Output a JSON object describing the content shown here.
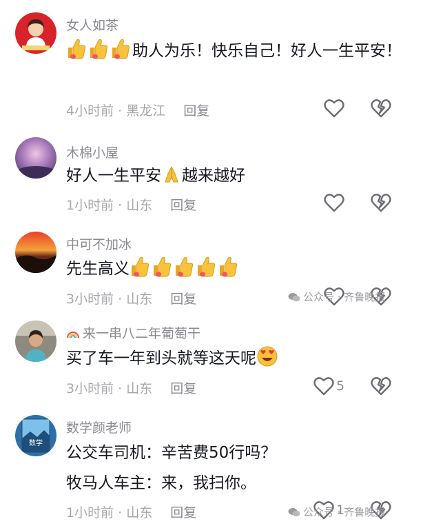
{
  "comments": [
    {
      "name": "女人如茶",
      "text": "助人为乐！快乐自己！好人一生平安！",
      "time": "4小时前 · 黑龙江",
      "reply": "回复"
    },
    {
      "name": "木棉小屋",
      "text_a": "好人一生平安",
      "text_b": "越来越好",
      "time": "1小时前 · 山东",
      "reply": "回复"
    },
    {
      "name": "中可不加冰",
      "text": "先生高义",
      "time": "3小时前 · 山东",
      "reply": "回复"
    },
    {
      "name": "来一串八二年葡萄干",
      "text": "买了车一年到头就等这天呢",
      "time": "3小时前 · 山东",
      "reply": "回复",
      "likes": "5"
    },
    {
      "name": "数学颜老师",
      "line1": "公交车司机：辛苦费50行吗？",
      "line2": "牧马人车主：来，我扫你。",
      "time": "1小时前 · 山东",
      "reply": "回复",
      "likes": "1"
    }
  ],
  "watermark": "公众号 · 齐鲁晚报",
  "avatar_5_text": "数学",
  "colors": {
    "text": "#161823",
    "secondary": "#8a8b91",
    "thumb": "#f6c33a"
  }
}
